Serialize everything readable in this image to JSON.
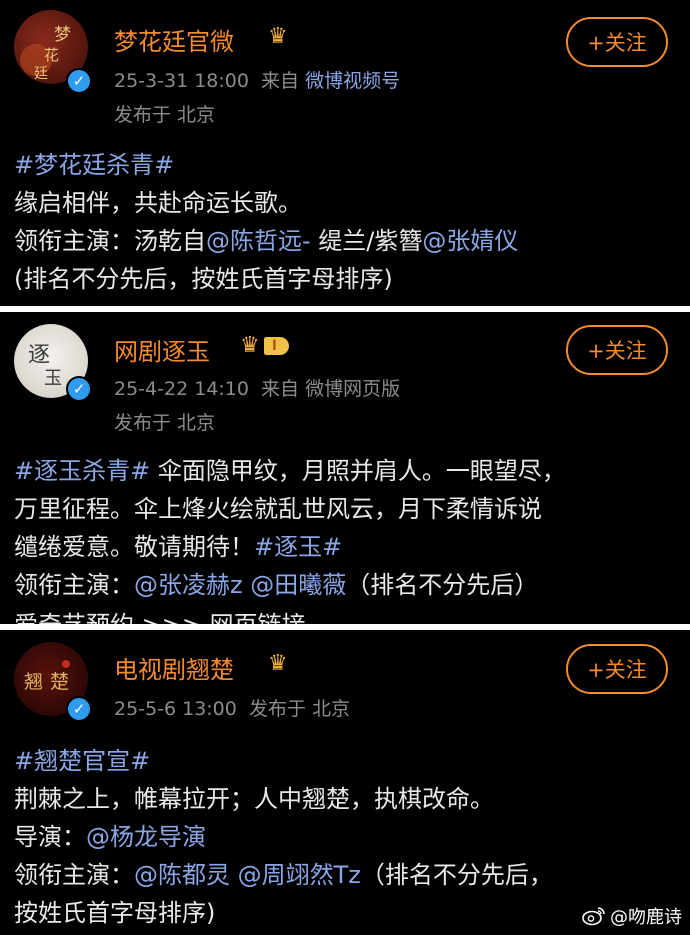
{
  "posts": [
    {
      "account_name": "梦花廷官微",
      "avatar_text": "梦花廷",
      "time": "25-3-31 18:00",
      "from_label": "来自",
      "source": "微博视频号",
      "location": "发布于 北京",
      "follow_label": "+关注",
      "lines": [
        {
          "tag": "#梦花廷杀青#"
        },
        {
          "text": "缘启相伴，共赴命运长歌。"
        },
        {
          "prefix": "领衔主演：汤乾自",
          "mention1": "@陈哲远-",
          "middle": " 缇兰/紫簪",
          "mention2": "@张婧仪"
        },
        {
          "text": "(排名不分先后，按姓氏首字母排序)"
        }
      ]
    },
    {
      "account_name": "网剧逐玉",
      "avatar_text": "逐玉",
      "level_badge": "I",
      "time": "25-4-22 14:10",
      "from_label": "来自",
      "source": "微博网页版",
      "location": "发布于 北京",
      "follow_label": "+关注",
      "lines": [
        {
          "tag": "#逐玉杀青#",
          "text": " 伞面隐甲纹，月照并肩人。一眼望尽，"
        },
        {
          "text": "万里征程。伞上烽火绘就乱世风云，月下柔情诉说"
        },
        {
          "text": "缱绻爱意。敬请期待！",
          "tag2": "#逐玉#"
        },
        {
          "prefix": "领衔主演：",
          "mention1": "@张凌赫z",
          "middle": " ",
          "mention2": "@田曦薇",
          "suffix": "（排名不分先后）"
        },
        {
          "partial": "爱奇艺预约 >>> 网页链接"
        }
      ]
    },
    {
      "account_name": "电视剧翘楚",
      "avatar_text": "翘楚",
      "time": "25-5-6 13:00",
      "location": "发布于 北京",
      "follow_label": "+关注",
      "lines": [
        {
          "tag": "#翘楚官宣#"
        },
        {
          "text": "荆棘之上，帷幕拉开；人中翘楚，执棋改命。"
        },
        {
          "prefix": "导演：",
          "mention1": "@杨龙导演"
        },
        {
          "prefix": "领衔主演：",
          "mention1": "@陈都灵",
          "middle": " ",
          "mention2": "@周翊然Tz",
          "suffix": "（排名不分先后，"
        },
        {
          "text": "按姓氏首字母排序)"
        }
      ]
    }
  ],
  "watermark": "@吻鹿诗",
  "colors": {
    "name": "#f28a2e",
    "link": "#8aa6e6",
    "meta": "#8c8c8c",
    "verified": "#2f9cf0"
  }
}
